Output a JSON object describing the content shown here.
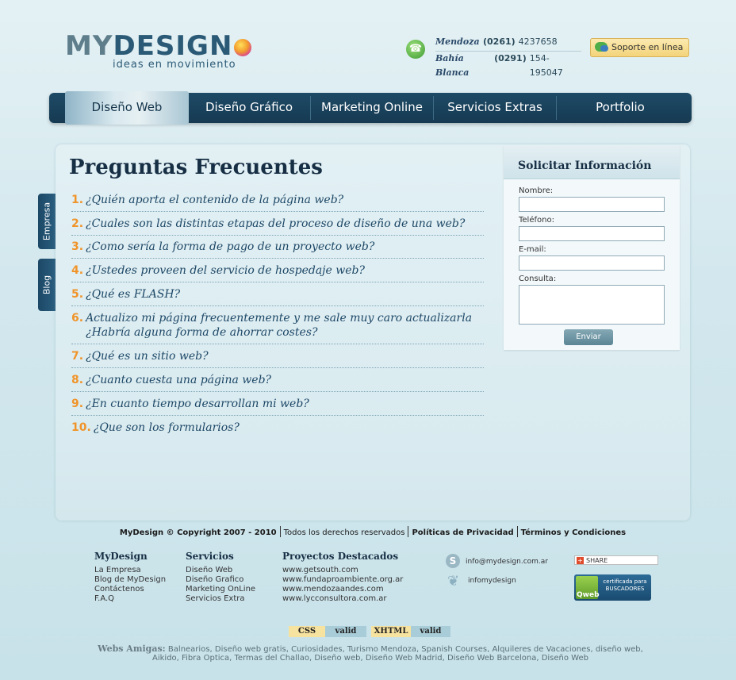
{
  "header": {
    "logo_main_a": "MY",
    "logo_main_b": "DESIGN",
    "logo_tagline": "ideas en movimiento",
    "contacts": [
      {
        "city": "Mendoza",
        "code": "(0261)",
        "number": "4237658"
      },
      {
        "city": "Bahía Blanca",
        "code": "(0291)",
        "number": "154-195047"
      }
    ],
    "support_label": "Soporte en línea"
  },
  "nav": {
    "items": [
      "Diseño Web",
      "Diseño Gráfico",
      "Marketing Online",
      "Servicios Extras",
      "Portfolio"
    ],
    "active": "Diseño Web"
  },
  "side_tabs": [
    "Empresa",
    "Blog"
  ],
  "faq": {
    "title": "Preguntas Frecuentes",
    "items": [
      {
        "num": "1.",
        "text": "¿Quién aporta el contenido de la página web?"
      },
      {
        "num": "2.",
        "text": "¿Cuales son las distintas etapas del proceso de diseño de una web?"
      },
      {
        "num": "3.",
        "text": "¿Como sería la forma de pago de un proyecto web?"
      },
      {
        "num": "4.",
        "text": "¿Ustedes proveen del servicio de hospedaje web?"
      },
      {
        "num": "5.",
        "text": "¿Qué es FLASH?"
      },
      {
        "num": "6.",
        "text": "Actualizo mi página frecuentemente y me sale muy caro actualizarla ¿Habría alguna forma de ahorrar costes?"
      },
      {
        "num": "7.",
        "text": "¿Qué es un sitio web?"
      },
      {
        "num": "8.",
        "text": "¿Cuanto cuesta una página web?"
      },
      {
        "num": "9.",
        "text": "¿En cuanto tiempo desarrollan mi web?"
      },
      {
        "num": "10.",
        "text": "¿Que son los formularios?"
      }
    ]
  },
  "form": {
    "title": "Solicitar Información",
    "name_label": "Nombre:",
    "phone_label": "Teléfono:",
    "email_label": "E-mail:",
    "query_label": "Consulta:",
    "submit_label": "Enviar"
  },
  "footer": {
    "copyright": "MyDesign © Copyright 2007 - 2010",
    "rights": "Todos los derechos reservados",
    "privacy": "Políticas de Privacidad",
    "terms": "Términos y Condiciones",
    "col_mydesign": {
      "title": "MyDesign",
      "links": [
        "La Empresa",
        "Blog de MyDesign",
        "Contáctenos",
        "F.A.Q"
      ]
    },
    "col_servicios": {
      "title": "Servicios",
      "links": [
        "Diseño Web",
        "Diseño Grafico",
        "Marketing OnLine",
        "Servicios Extra"
      ]
    },
    "col_proyectos": {
      "title": "Proyectos Destacados",
      "links": [
        "www.getsouth.com",
        "www.fundaproambiente.org.ar",
        "www.mendozaandes.com",
        "www.lycconsultora.com.ar"
      ]
    },
    "skype_id": "info@mydesign.com.ar",
    "msn_id": "infomydesign",
    "share_label": "SHARE",
    "qweb_brand": "Qweb",
    "qweb_text": "certificada para BUSCADORES",
    "css_label": "CSS",
    "css_valid": "valid",
    "xhtml_label": "XHTML",
    "xhtml_valid": "valid",
    "amigas_label": "Webs Amigas:",
    "amigas_links": "Balnearios, Diseño web gratis, Curiosidades, Turismo Mendoza, Spanish Courses, Alquileres de Vacaciones, diseño web, Aikido, Fibra Optica, Termas del Challao, Diseño web, Diseño Web Madrid, Diseño Web Barcelona, Diseño Web"
  },
  "colors": {
    "nav_bg": "#1e4a66",
    "accent_orange": "#f0942a",
    "title_dark": "#172f44",
    "css_badge": "#f7e3a0",
    "valid_badge": "#a9cdd8"
  }
}
